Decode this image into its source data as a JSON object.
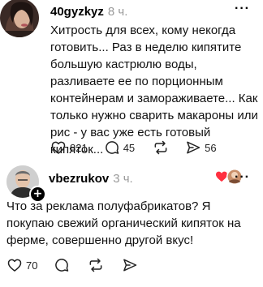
{
  "posts": [
    {
      "username": "40gyzkyz",
      "time": "8 ч.",
      "more": "···",
      "text": "Хитрость для всех, кому некогда готовить... Раз в неделю кипятите большую кастрюлю воды, разливаете ее по порционным контейнерам и замораживаете... Как только нужно сварить макароны или рис - у вас уже есть готовый кипяток...",
      "likes": "821",
      "comments": "45",
      "reposts": "",
      "shares": "56"
    },
    {
      "username": "vbezrukov",
      "time": "3 ч.",
      "more": "···",
      "badge": "+",
      "text": "Что за реклама полуфабрикатов? Я покупаю свежий органический кипяток на ферме, совершенно другой вкус!",
      "likes": "70",
      "comments": "",
      "reposts": "",
      "shares": ""
    }
  ],
  "icons": {
    "like": "heart-icon",
    "comment": "comment-bubble-icon",
    "repost": "repost-arrows-icon",
    "share": "send-icon",
    "more": "more-dots-icon"
  }
}
